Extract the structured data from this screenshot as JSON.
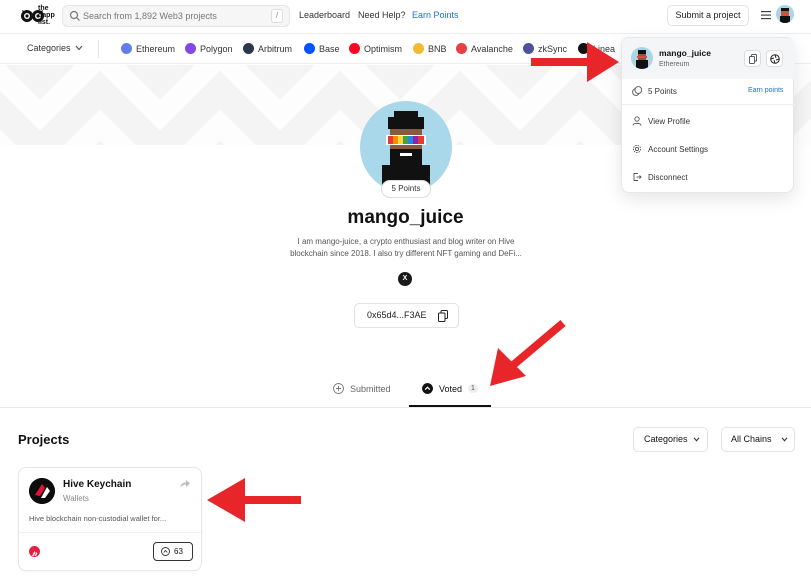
{
  "header": {
    "logo_text": [
      "the",
      "dapp",
      "list."
    ],
    "search_placeholder": "Search from 1,892 Web3 projects",
    "search_shortcut": "/",
    "nav": {
      "leaderboard": "Leaderboard",
      "help": "Need Help?",
      "earn": "Earn Points"
    },
    "submit_label": "Submit a project"
  },
  "subnav": {
    "categories_label": "Categories",
    "chains": [
      {
        "label": "Ethereum",
        "color": "#627eea"
      },
      {
        "label": "Polygon",
        "color": "#8247e5"
      },
      {
        "label": "Arbitrum",
        "color": "#2d374b"
      },
      {
        "label": "Base",
        "color": "#0052ff"
      },
      {
        "label": "Optimism",
        "color": "#ff0420"
      },
      {
        "label": "BNB",
        "color": "#f3ba2f"
      },
      {
        "label": "Avalanche",
        "color": "#e84142"
      },
      {
        "label": "zkSync",
        "color": "#4e529a"
      },
      {
        "label": "Linea",
        "color": "#121212"
      }
    ]
  },
  "profile": {
    "points_badge": "5 Points",
    "username": "mango_juice",
    "bio": "I am mango-juice, a crypto enthusiast and blog writer on Hive blockchain since 2018. I also try different NFT gaming and DeFi...",
    "x_label": "X",
    "address": "0x65d4...F3AE"
  },
  "tabs": {
    "submitted": "Submitted",
    "voted": "Voted",
    "voted_count": "1"
  },
  "projects": {
    "heading": "Projects",
    "categories_filter": "Categories",
    "chains_filter": "All Chains",
    "cards": [
      {
        "title": "Hive Keychain",
        "category": "Wallets",
        "description": "Hive blockchain non-custodial wallet for...",
        "votes": "63",
        "chain_color": "#e61f3f"
      }
    ]
  },
  "user_menu": {
    "username": "mango_juice",
    "chain": "Ethereum",
    "points": "5 Points",
    "earn_points": "Earn points",
    "view_profile": "View Profile",
    "account_settings": "Account Settings",
    "disconnect": "Disconnect"
  },
  "colors": {
    "accent": "#1d6fe0",
    "arrow": "#e8262a"
  }
}
